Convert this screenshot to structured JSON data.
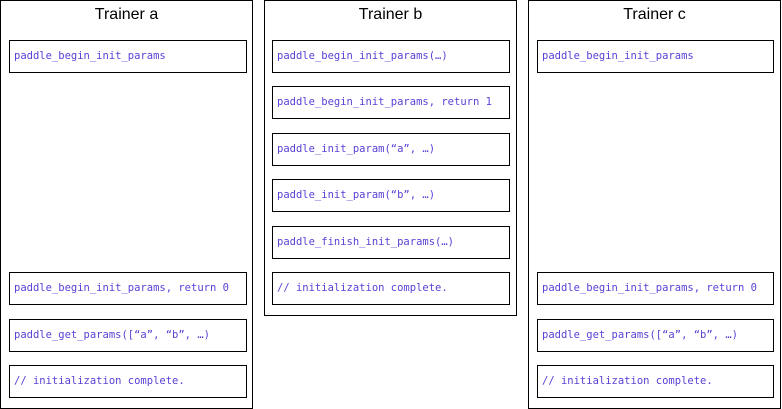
{
  "code_color": "#5b3fd6",
  "trainers": [
    {
      "title": "Trainer a",
      "steps": [
        "paddle_begin_init_params",
        "paddle_begin_init_params, return 0",
        "paddle_get_params([“a”, “b”, …)",
        "// initialization complete."
      ]
    },
    {
      "title": "Trainer b",
      "steps": [
        "paddle_begin_init_params(…)",
        "paddle_begin_init_params, return 1",
        "paddle_init_param(“a”, …)",
        "paddle_init_param(“b”, …)",
        "paddle_finish_init_params(…)",
        "// initialization complete."
      ]
    },
    {
      "title": "Trainer c",
      "steps": [
        "paddle_begin_init_params",
        "paddle_begin_init_params, return 0",
        "paddle_get_params([“a”, “b”, …)",
        "// initialization complete."
      ]
    }
  ]
}
